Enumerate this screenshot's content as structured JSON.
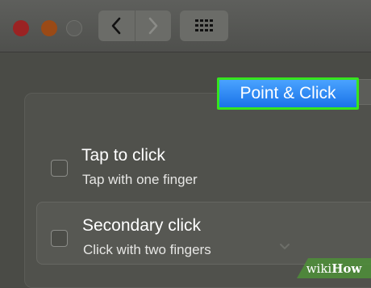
{
  "window": {
    "traffic_lights": [
      "close-button",
      "minimize-button",
      "zoom-button"
    ],
    "nav": {
      "back_icon": "chevron-left-icon",
      "forward_icon": "chevron-right-icon"
    },
    "show_all_icon": "grid-icon"
  },
  "tabs": {
    "active_label": "Point & Click"
  },
  "options": [
    {
      "title": "Tap to click",
      "subtitle": "Tap with one finger",
      "checked": false
    },
    {
      "title": "Secondary click",
      "subtitle": "Click with two fingers",
      "checked": false
    }
  ],
  "watermark": {
    "prefix": "wiki",
    "suffix": "How"
  },
  "colors": {
    "accent": "#36e51e",
    "tab_blue": "#1a73e8"
  }
}
